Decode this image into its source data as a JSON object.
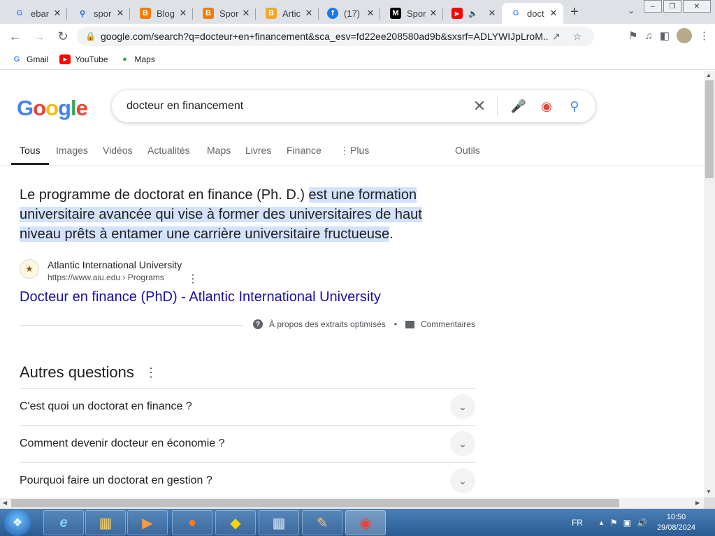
{
  "browser": {
    "tabs": [
      {
        "title": "ebar",
        "icon": "google-icon",
        "color": "#4285f4"
      },
      {
        "title": "spor",
        "icon": "search-icon",
        "color": "#1a73e8"
      },
      {
        "title": "Blog",
        "icon": "blogger-icon",
        "color": "#f57c00"
      },
      {
        "title": "Spor",
        "icon": "blogger-icon",
        "color": "#f57c00"
      },
      {
        "title": "Artic",
        "icon": "blogger-icon",
        "color": "#f5a623"
      },
      {
        "title": "(17)",
        "icon": "facebook-icon",
        "color": "#1877f2"
      },
      {
        "title": "Spor",
        "icon": "medium-icon",
        "color": "#000000"
      },
      {
        "title": "",
        "icon": "youtube-icon",
        "color": "#ff0000"
      },
      {
        "title": "doct",
        "icon": "google-icon",
        "color": "#4285f4"
      }
    ],
    "new_tab": "+",
    "url": "google.com/search?q=docteur+en+financement&sca_esv=fd22ee208580ad9b&sxsrf=ADLYWIJpLroM...",
    "bookmarks": [
      {
        "label": "Gmail",
        "icon": "google-icon"
      },
      {
        "label": "YouTube",
        "icon": "youtube-icon"
      },
      {
        "label": "Maps",
        "icon": "maps-icon"
      }
    ]
  },
  "google": {
    "logo": "Google",
    "query": "docteur en financement",
    "tabs": [
      "Tous",
      "Images",
      "Vidéos",
      "Actualités",
      "Maps",
      "Livres",
      "Finance",
      "Plus",
      "Outils"
    ],
    "snippet": {
      "plain_start": "Le programme de doctorat en finance (Ph. D.) ",
      "highlighted": "est une formation universitaire avancée qui vise à former des universitaires de haut niveau prêts à entamer une carrière universitaire fructueuse",
      "plain_end": "."
    },
    "source": {
      "name": "Atlantic International University",
      "cite": "https://www.aiu.edu › Programs"
    },
    "result_link": "Docteur en finance (PhD) - Atlantic International University",
    "about": "À propos des extraits optimisés",
    "feedback": "Commentaires",
    "paa_title": "Autres questions",
    "paa": [
      "C'est quoi un doctorat en finance ?",
      "Comment devenir docteur en économie ?",
      "Pourquoi faire un doctorat en gestion ?"
    ]
  },
  "taskbar": {
    "lang": "FR",
    "time": "10:50",
    "date": "29/08/2024"
  }
}
